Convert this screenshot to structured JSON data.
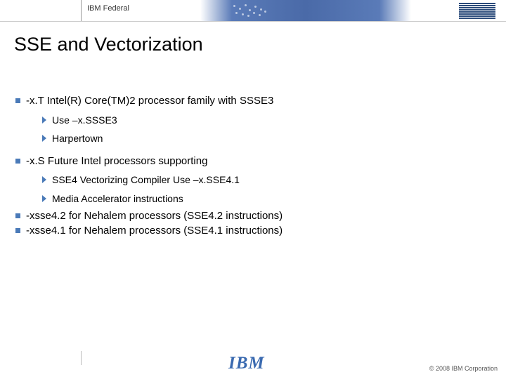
{
  "header": {
    "label": "IBM Federal",
    "logo_alt": "IBM"
  },
  "title": "SSE and Vectorization",
  "bullets": [
    {
      "text": "-x.T  Intel(R) Core(TM)2 processor family with SSSE3",
      "children": [
        {
          "text": "Use –x.SSSE3"
        },
        {
          "text": "Harpertown"
        }
      ]
    },
    {
      "text": "-x.S  Future Intel processors supporting",
      "children": [
        {
          "text": "SSE4 Vectorizing Compiler Use –x.SSE4.1"
        },
        {
          "text": "Media Accelerator instructions"
        }
      ]
    },
    {
      "text": "-xsse4.2 for Nehalem processors (SSE4.2 instructions)"
    },
    {
      "text": "-xsse4.1 for Nehalem processors (SSE4.1 instructions)"
    }
  ],
  "footer": {
    "logo": "IBM",
    "copyright": "© 2008 IBM Corporation"
  }
}
